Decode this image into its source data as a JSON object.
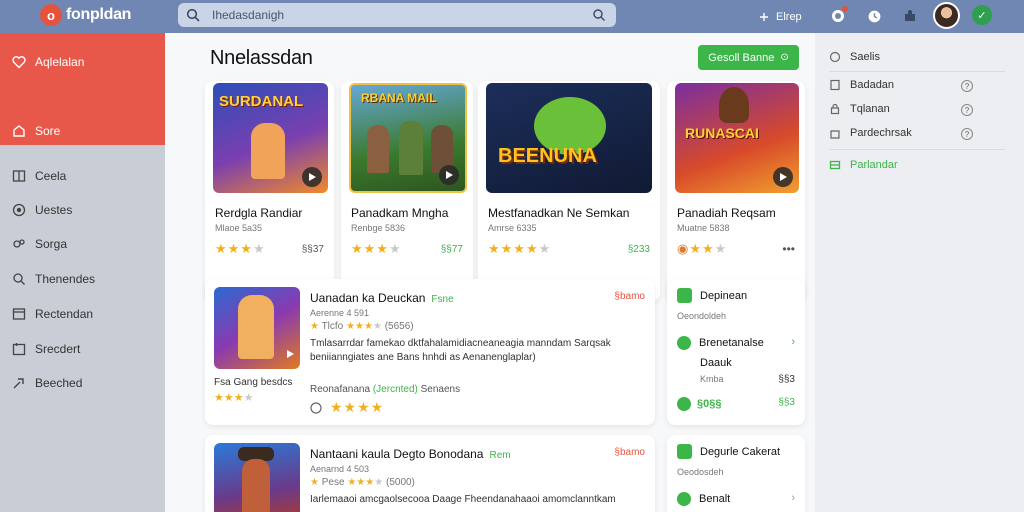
{
  "header": {
    "logo_letter": "o",
    "logo_text": "fonpldan",
    "search_placeholder": "Ihedasdanigh",
    "top_link": "Elrep",
    "accent": "#6f87b2"
  },
  "sidebar": {
    "items": [
      {
        "label": "Aqlelalan",
        "icon": "heart-icon",
        "active_group": true
      },
      {
        "label": "Sore",
        "icon": "home-icon",
        "active_group": true
      },
      {
        "label": "Ceela",
        "icon": "grid-icon"
      },
      {
        "label": "Uestes",
        "icon": "target-icon"
      },
      {
        "label": "Sorga",
        "icon": "gamepad-icon"
      },
      {
        "label": "Thenendes",
        "icon": "search-icon"
      },
      {
        "label": "Rectendan",
        "icon": "window-icon"
      },
      {
        "label": "Srecdert",
        "icon": "calendar-icon"
      },
      {
        "label": "Beeched",
        "icon": "share-icon"
      }
    ],
    "accent": "#e8584a"
  },
  "main": {
    "title": "Nnelassdan",
    "primary_button": "Gesoll Banne",
    "cards": [
      {
        "title": "Rerdgla Randiar",
        "sub": "Mlaoe 5a35",
        "stars": 4,
        "price": "§§37",
        "price_green": false,
        "art_text": "SURDANAL"
      },
      {
        "title": "Panadkam Mngha",
        "sub": "Renbge 5836",
        "stars": 4,
        "price": "§§77",
        "price_green": true,
        "art_text": "RBANA MAIL"
      },
      {
        "title": "Mestfanadkan Ne Semkan",
        "sub": "Amrse 6335",
        "stars": 4,
        "price": "§233",
        "price_green": true,
        "art_text": "BEENUNA"
      },
      {
        "title": "Panadiah Reqsam",
        "sub": "Muatne 5838",
        "stars": 3,
        "price": "•••",
        "price_green": false,
        "art_text": "RUNASCAI"
      }
    ],
    "list": [
      {
        "title": "Uanadan ka Deuckan",
        "tag": "Fsne",
        "meta": "Aerenne 4 591",
        "rate_label": "Tlcfo",
        "rate_count": "(5656)",
        "price": "§bamo",
        "desc": "Tmlasarrdar famekao dktfahalamidiacneaneagia manndam Sarqsak beniianngiates ane Bans hnhdi as Aenanenglaplar)",
        "left_note": "Fsa Gang besdcs",
        "foot_a": "Reonafanana",
        "foot_b": "(Jercnted)",
        "foot_c": "Senaens"
      },
      {
        "title": "Nantaani kaula Degto Bonodana",
        "tag": "Rem",
        "meta": "Aenarnd 4 503",
        "rate_label": "Pese",
        "rate_count": "(5000)",
        "price": "§bamo",
        "desc": "Iarlemaaoi amcgaolsecooa Daage Fheendanahaaoi amomclanntkam"
      }
    ],
    "side_cards": [
      {
        "title": "Depinean",
        "sub": "Oeondoldeh",
        "line1": "Brenetanalse",
        "line2": "Daauk",
        "line3": "Kmba",
        "val": "§§3",
        "foot": "§0§§"
      },
      {
        "title": "Degurle Cakerat",
        "sub": "Oeodosdeh",
        "line1": "Benalt"
      }
    ]
  },
  "right_panel": {
    "items": [
      {
        "label": "Saelis",
        "icon": "circle-icon"
      },
      {
        "label": "Badadan",
        "icon": "doc-icon",
        "help": "?"
      },
      {
        "label": "Tqlanan",
        "icon": "lock-icon",
        "help": "?"
      },
      {
        "label": "Pardechrsak",
        "icon": "bag-icon",
        "help": "?"
      },
      {
        "label": "Parlandar",
        "icon": "list-icon",
        "active": true
      }
    ],
    "accent": "#3cb549"
  }
}
